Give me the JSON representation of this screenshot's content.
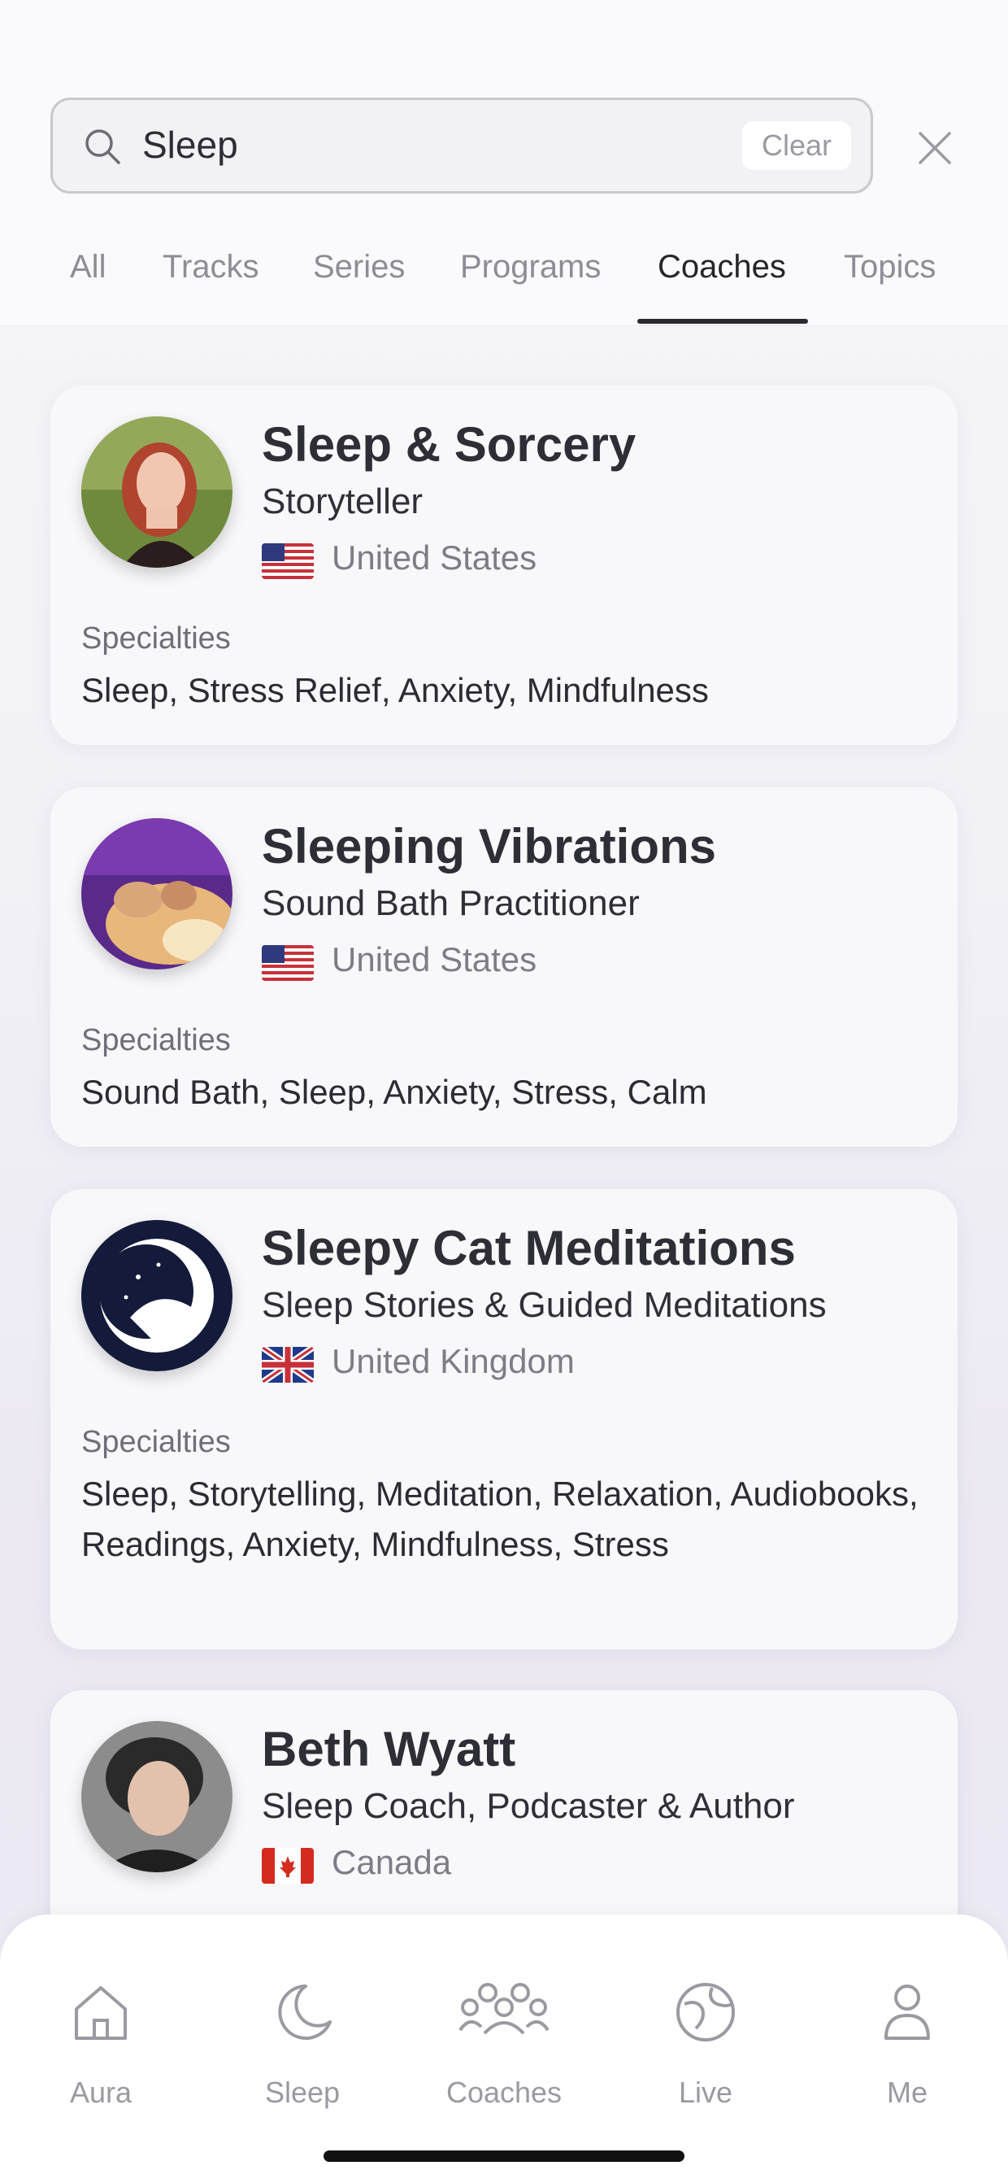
{
  "search": {
    "query": "Sleep",
    "clear_label": "Clear"
  },
  "tabs": [
    {
      "label": "All"
    },
    {
      "label": "Tracks"
    },
    {
      "label": "Series"
    },
    {
      "label": "Programs"
    },
    {
      "label": "Coaches"
    },
    {
      "label": "Topics"
    }
  ],
  "active_tab": "Coaches",
  "coaches": [
    {
      "name": "Sleep & Sorcery",
      "role": "Storyteller",
      "country": "United States",
      "flag": "us-flag",
      "specialties_label": "Specialties",
      "specialties": "Sleep, Stress Relief, Anxiety, Mindfulness"
    },
    {
      "name": "Sleeping Vibrations",
      "role": "Sound Bath Practitioner",
      "country": "United States",
      "flag": "us-flag",
      "specialties_label": "Specialties",
      "specialties": "Sound Bath, Sleep, Anxiety, Stress, Calm"
    },
    {
      "name": "Sleepy Cat Meditations",
      "role": "Sleep Stories & Guided Meditations",
      "country": "United Kingdom",
      "flag": "uk-flag",
      "specialties_label": "Specialties",
      "specialties": "Sleep, Storytelling, Meditation, Relaxation, Audiobooks, Readings, Anxiety, Mindfulness, Stress"
    },
    {
      "name": "Beth Wyatt",
      "role": "Sleep Coach, Podcaster & Author",
      "country": "Canada",
      "flag": "canada-flag"
    }
  ],
  "nav": [
    {
      "label": "Aura",
      "icon": "home-icon"
    },
    {
      "label": "Sleep",
      "icon": "moon-icon"
    },
    {
      "label": "Coaches",
      "icon": "group-icon"
    },
    {
      "label": "Live",
      "icon": "globe-icon"
    },
    {
      "label": "Me",
      "icon": "person-icon"
    }
  ],
  "colors": {
    "accent": "#2a2a31",
    "muted": "#8d8d96",
    "card": "#f8f8fb"
  }
}
